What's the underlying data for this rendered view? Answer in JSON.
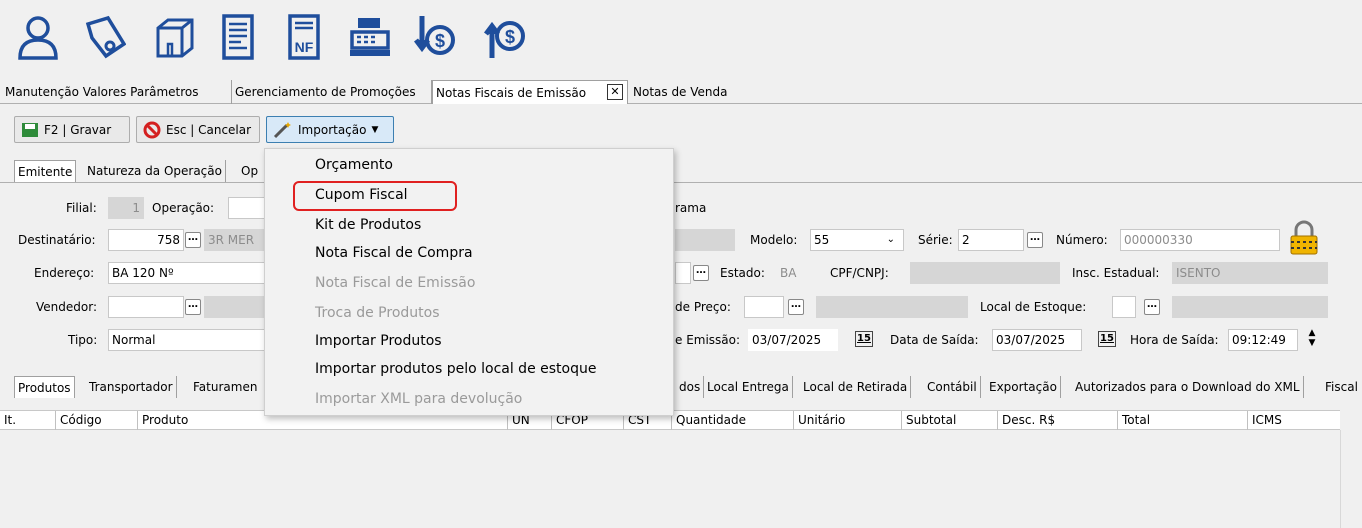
{
  "toolbar_icons": [
    "user-icon",
    "tag-icon",
    "box-icon",
    "document-icon",
    "nf-document-icon",
    "cash-register-icon",
    "dollar-down-icon",
    "dollar-up-icon"
  ],
  "nf_label": "NF",
  "tabs": [
    {
      "label": "Manutenção Valores Parâmetros"
    },
    {
      "label": "Gerenciamento de Promoções"
    },
    {
      "label": "Notas Fiscais de Emissão"
    },
    {
      "label": "Notas de Venda"
    }
  ],
  "tab_close": "✕",
  "actions": {
    "save": "F2 | Gravar",
    "cancel": "Esc | Cancelar",
    "import": "Importação"
  },
  "subtabs": [
    "Emitente",
    "Natureza da Operação",
    "Op"
  ],
  "form": {
    "filial_label": "Filial:",
    "filial": "1",
    "operacao_label": "Operação:",
    "programa_tail": "rama",
    "destinatario_label": "Destinatário:",
    "destinatario": "758",
    "destinatario_name": "3R MER",
    "modelo_label": "Modelo:",
    "modelo": "55",
    "serie_label": "Série:",
    "serie": "2",
    "numero_label": "Número:",
    "numero": "000000330",
    "endereco_label": "Endereço:",
    "endereco": "BA 120 Nº",
    "estado_label": "Estado:",
    "estado": "BA",
    "cpf_label": "CPF/CNPJ:",
    "insc_label": "Insc. Estadual:",
    "insc": "ISENTO",
    "vendedor_label": "Vendedor:",
    "tabela_label": "de Preço:",
    "local_estoque_label": "Local de Estoque:",
    "tipo_label": "Tipo:",
    "tipo": "Normal",
    "emissao_label": "e Emissão:",
    "emissao": "03/07/2025",
    "saida_label": "Data de Saída:",
    "saida": "03/07/2025",
    "hora_label": "Hora de Saída:",
    "hora": "09:12:49",
    "cal_glyph": "15"
  },
  "bottom_tabs_left": [
    "Produtos",
    "Transportador",
    "Faturamen"
  ],
  "bottom_tabs_right": [
    "dos",
    "Local Entrega",
    "Local de Retirada",
    "Contábil",
    "Exportação",
    "Autorizados para o Download do XML",
    "Fiscal"
  ],
  "grid_columns": [
    "It.",
    "Código",
    "Produto",
    "UN",
    "CFOP",
    "CST",
    "Quantidade",
    "Unitário",
    "Subtotal",
    "Desc. R$",
    "Total",
    "ICMS"
  ],
  "menu": [
    {
      "label": "Orçamento",
      "enabled": true
    },
    {
      "label": "Cupom Fiscal",
      "enabled": true,
      "highlighted": true
    },
    {
      "label": "Kit de Produtos",
      "enabled": true
    },
    {
      "label": "Nota Fiscal de Compra",
      "enabled": true
    },
    {
      "label": "Nota Fiscal de Emissão",
      "enabled": false
    },
    {
      "label": "Troca de Produtos",
      "enabled": false
    },
    {
      "label": "Importar Produtos",
      "enabled": true
    },
    {
      "label": "Importar produtos pelo local de estoque",
      "enabled": true
    },
    {
      "label": "Importar XML para devolução",
      "enabled": false
    }
  ],
  "colors": {
    "icon_blue": "#1f4e9c",
    "highlight_red": "#e02020",
    "cancel_red": "#d42020",
    "save_green": "#2e8b3a"
  }
}
